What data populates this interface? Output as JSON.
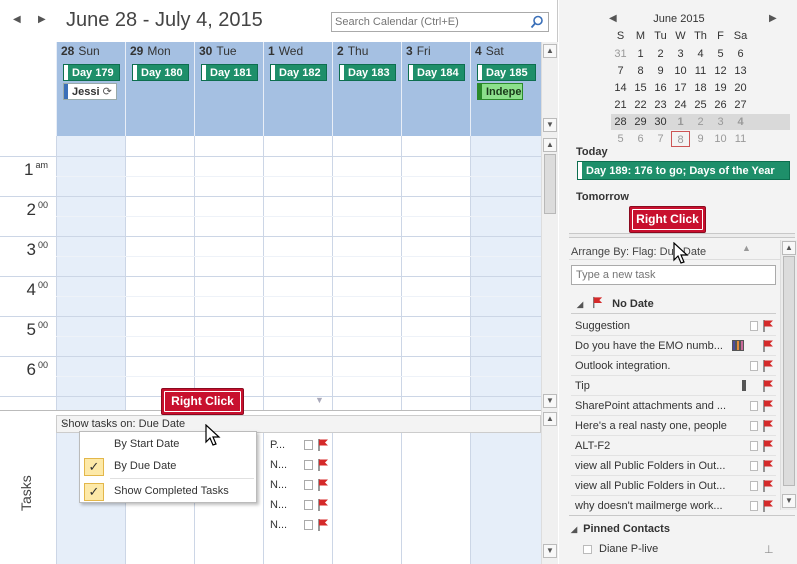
{
  "calendar": {
    "title": "June 28 - July 4, 2015",
    "search_placeholder": "Search Calendar (Ctrl+E)",
    "days": [
      {
        "num": "28",
        "name": "Sun",
        "weekend": true
      },
      {
        "num": "29",
        "name": "Mon",
        "weekend": false
      },
      {
        "num": "30",
        "name": "Tue",
        "weekend": false
      },
      {
        "num": "1",
        "name": "Wed",
        "weekend": false
      },
      {
        "num": "2",
        "name": "Thu",
        "weekend": false
      },
      {
        "num": "3",
        "name": "Fri",
        "weekend": false
      },
      {
        "num": "4",
        "name": "Sat",
        "weekend": true
      }
    ],
    "all_day_events": [
      "Day 179",
      "Day 180",
      "Day 181",
      "Day 182",
      "Day 183",
      "Day 184",
      "Day 185"
    ],
    "sunday_extra_event": "Jessi",
    "saturday_extra_event": "Indepe",
    "hours": [
      {
        "num": "1",
        "suffix": "am"
      },
      {
        "num": "2",
        "suffix": "00"
      },
      {
        "num": "3",
        "suffix": "00"
      },
      {
        "num": "4",
        "suffix": "00"
      },
      {
        "num": "5",
        "suffix": "00"
      },
      {
        "num": "6",
        "suffix": "00"
      }
    ]
  },
  "tasks_area": {
    "label": "Tasks",
    "show_tasks_on": "Show tasks on: Due Date",
    "items": [
      "P...",
      "N...",
      "N...",
      "N...",
      "N..."
    ]
  },
  "context_menu": {
    "items": [
      {
        "label": "By Start Date",
        "checked": false
      },
      {
        "label": "By Due Date",
        "checked": true
      },
      {
        "label": "Show Completed Tasks",
        "checked": true
      }
    ],
    "check_glyph": "✓"
  },
  "callouts": {
    "left": "Right Click",
    "right": "Right Click"
  },
  "mini_calendar": {
    "title": "June 2015",
    "dow": [
      "S",
      "M",
      "Tu",
      "W",
      "Th",
      "F",
      "Sa"
    ],
    "weeks": [
      [
        "31",
        "1",
        "2",
        "3",
        "4",
        "5",
        "6"
      ],
      [
        "7",
        "8",
        "9",
        "10",
        "11",
        "12",
        "13"
      ],
      [
        "14",
        "15",
        "16",
        "17",
        "18",
        "19",
        "20"
      ],
      [
        "21",
        "22",
        "23",
        "24",
        "25",
        "26",
        "27"
      ],
      [
        "28",
        "29",
        "30",
        "1",
        "2",
        "3",
        "4"
      ],
      [
        "5",
        "6",
        "7",
        "8",
        "9",
        "10",
        "11"
      ]
    ],
    "selected_week": 4,
    "today": "8"
  },
  "peek": {
    "today_label": "Today",
    "today_event": "Day 189: 176 to go; Days of the Year",
    "tomorrow_label": "Tomorrow"
  },
  "task_list": {
    "arrange": "Arrange By: Flag: Due Date",
    "new_task_placeholder": "Type a new task",
    "group": "No Date",
    "items": [
      {
        "text": "Suggestion",
        "cats": []
      },
      {
        "text": "Do you have the EMO numb...",
        "cats": [
          "#4b4b9c",
          "#e08a3c",
          "#c86a9a"
        ]
      },
      {
        "text": "Outlook integration.",
        "cats": []
      },
      {
        "text": "Tip",
        "cats": [
          "#555555"
        ]
      },
      {
        "text": "SharePoint attachments and ...",
        "cats": []
      },
      {
        "text": "Here's a real nasty one, people",
        "cats": []
      },
      {
        "text": "ALT-F2",
        "cats": []
      },
      {
        "text": "view all Public Folders in Out...",
        "cats": []
      },
      {
        "text": "view all Public Folders in Out...",
        "cats": []
      },
      {
        "text": "why doesn't mailmerge work...",
        "cats": []
      }
    ],
    "pinned_label": "Pinned Contacts",
    "contact": "Diane P-live"
  },
  "colors": {
    "header_blue": "#a5c0e2",
    "event_green": "#1e8f6a",
    "flag_red": "#d42a2a",
    "callout_red": "#c8102e"
  }
}
